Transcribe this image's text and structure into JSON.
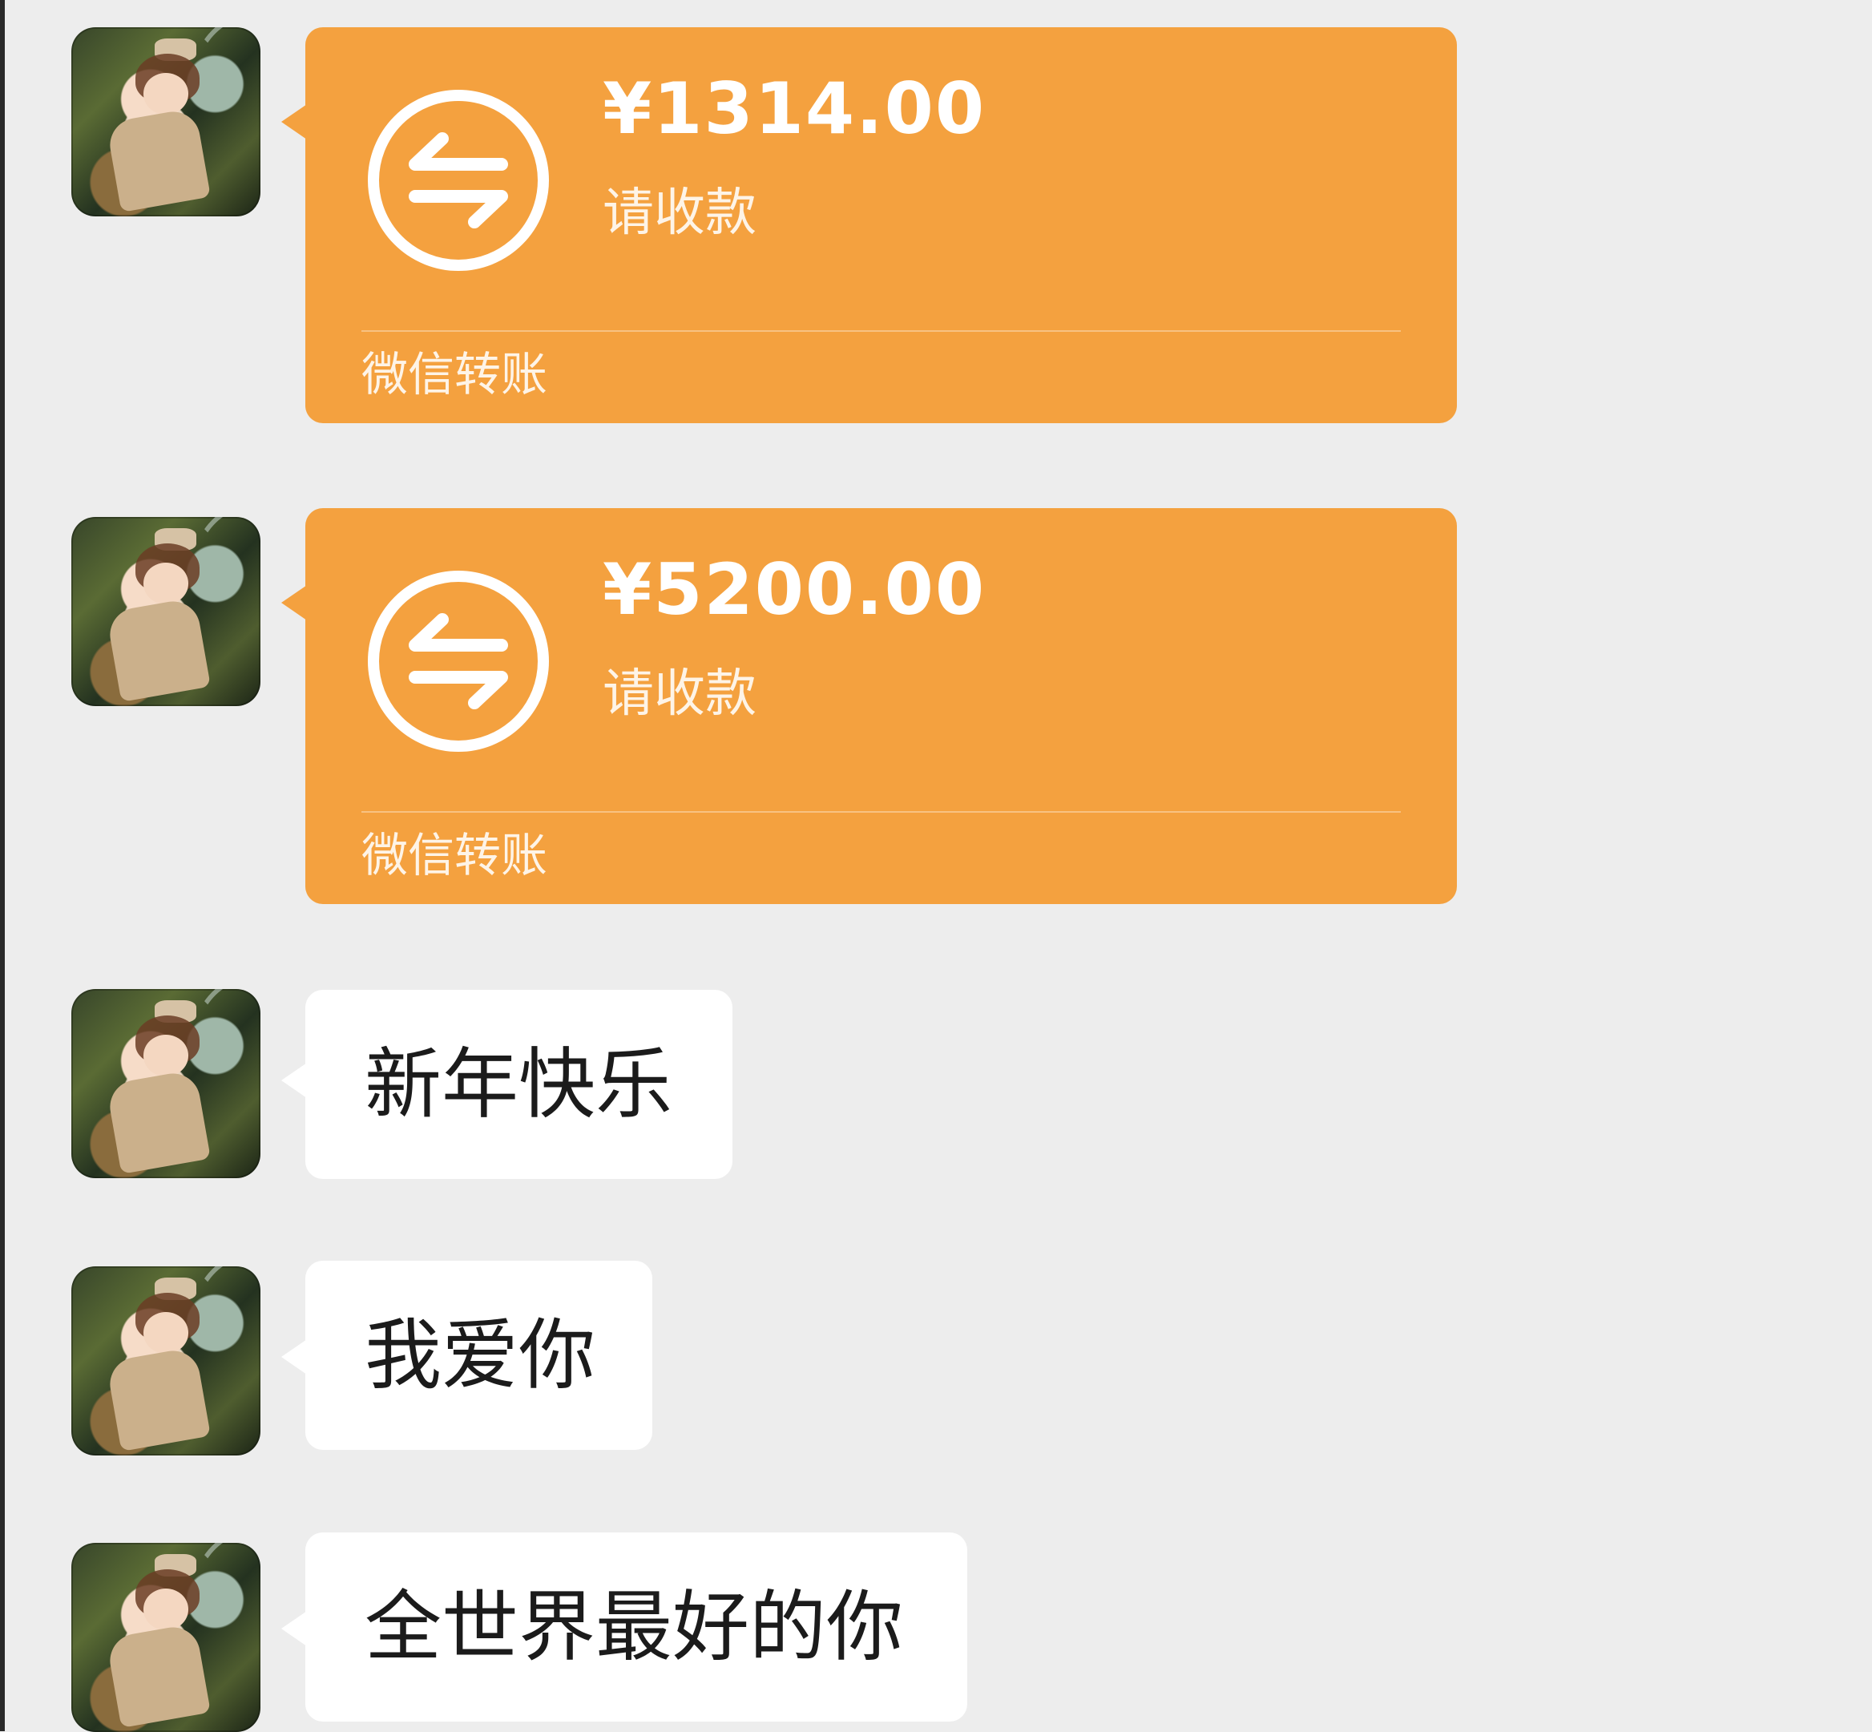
{
  "messages": [
    {
      "type": "transfer",
      "amount": "¥1314.00",
      "status": "请收款",
      "footer": "微信转账"
    },
    {
      "type": "transfer",
      "amount": "¥5200.00",
      "status": "请收款",
      "footer": "微信转账"
    },
    {
      "type": "text",
      "text": "新年快乐"
    },
    {
      "type": "text",
      "text": "我爱你"
    },
    {
      "type": "text",
      "text": "全世界最好的你"
    }
  ],
  "colors": {
    "background": "#ededed",
    "transfer_card": "#f4a13f",
    "text_bubble": "#ffffff",
    "text": "#1b1b1b"
  },
  "icons": {
    "transfer": "transfer-arrows-icon",
    "avatar": "avatar-photo"
  }
}
